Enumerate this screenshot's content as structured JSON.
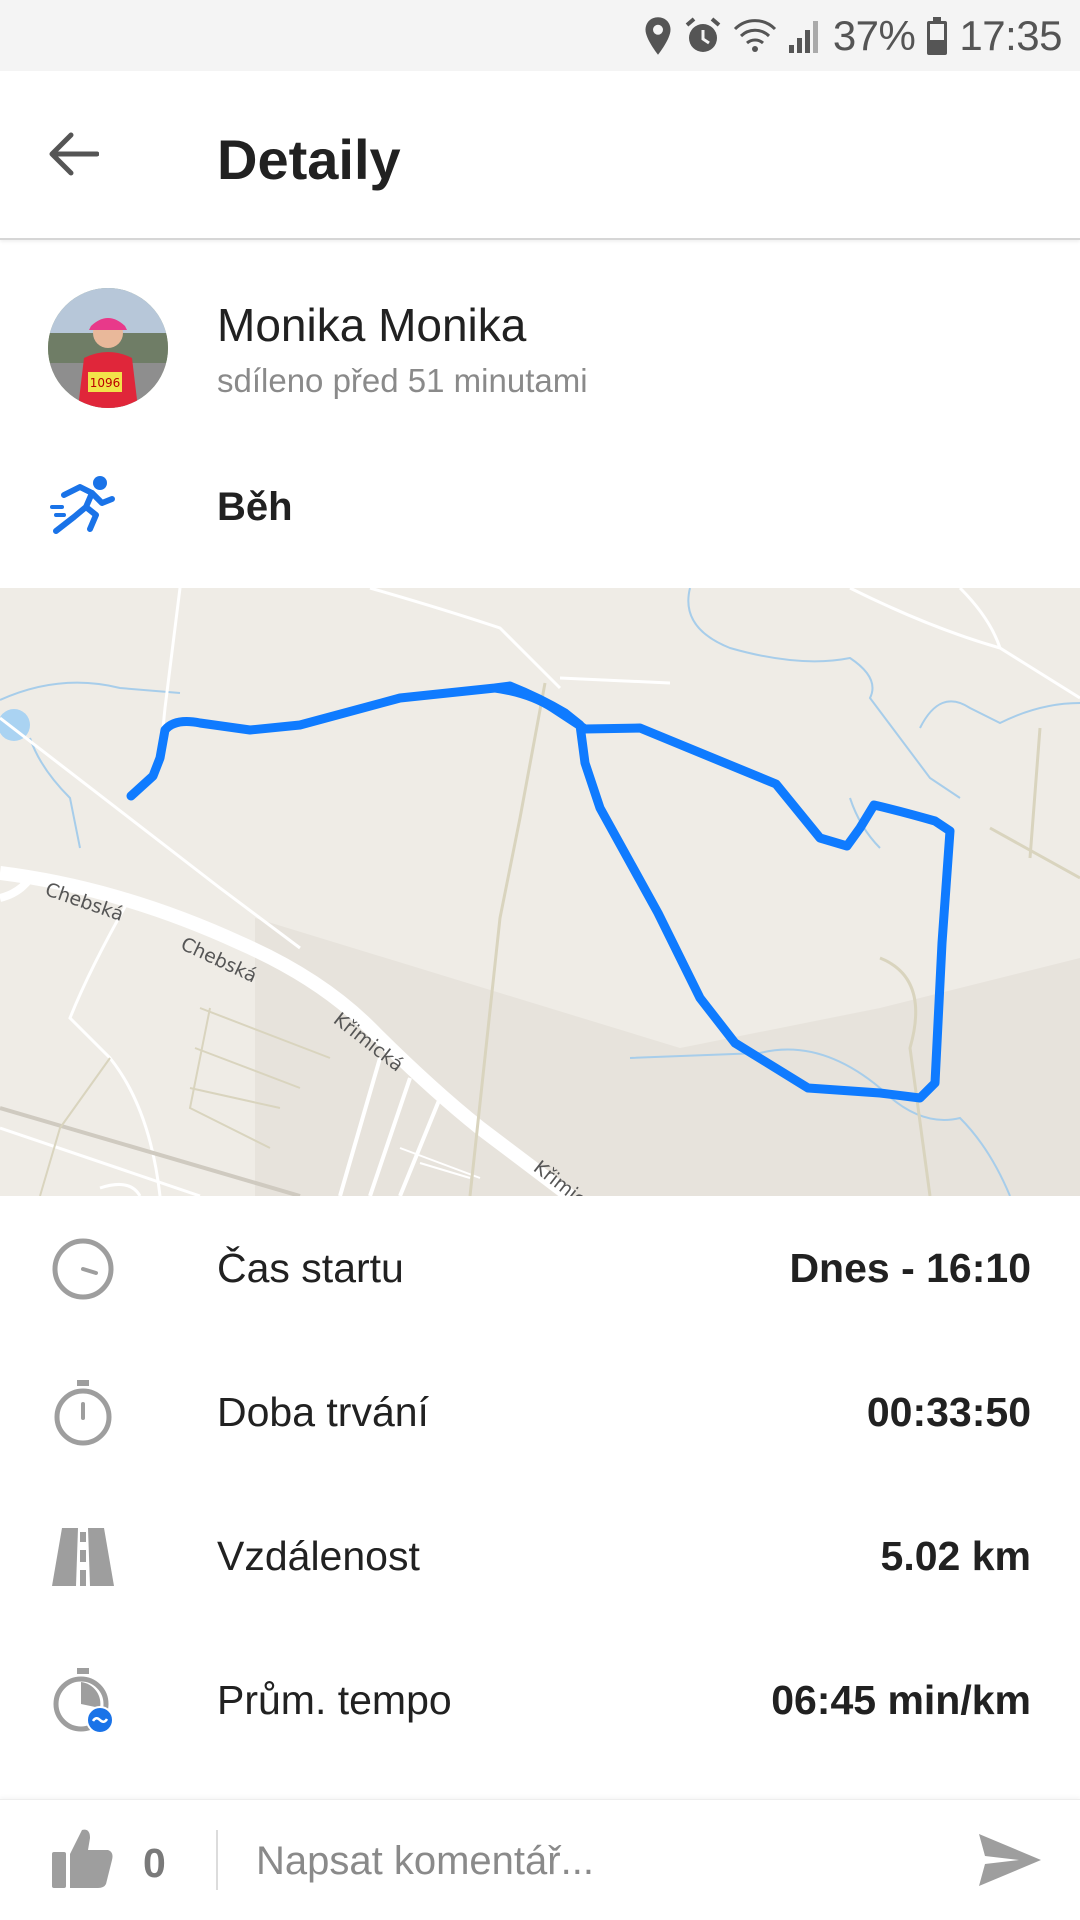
{
  "status_bar": {
    "battery": "37%",
    "time": "17:35",
    "icons": [
      "location-icon",
      "alarm-icon",
      "wifi-icon",
      "signal-icon",
      "battery-icon"
    ]
  },
  "app_bar": {
    "title": "Detaily",
    "back_icon": "arrow-back-icon"
  },
  "profile": {
    "name": "Monika Monika",
    "shared": "sdíleno před 51 minutami"
  },
  "activity": {
    "label": "Běh",
    "icon": "running-icon"
  },
  "map": {
    "street_labels": [
      "Chebská",
      "Chebská",
      "Křimická",
      "Křimick"
    ],
    "route_color": "#0f7bff"
  },
  "stats": [
    {
      "icon": "clock-icon",
      "label": "Čas startu",
      "value": "Dnes - 16:10"
    },
    {
      "icon": "stopwatch-icon",
      "label": "Doba trvání",
      "value": "00:33:50"
    },
    {
      "icon": "road-icon",
      "label": "Vzdálenost",
      "value": "5.02 km"
    },
    {
      "icon": "pace-icon",
      "label": "Prům. tempo",
      "value": "06:45 min/km"
    }
  ],
  "footer": {
    "like_count": "0",
    "comment_placeholder": "Napsat komentář...",
    "like_icon": "thumbs-up-icon",
    "send_icon": "send-icon"
  },
  "colors": {
    "accent": "#1a73e8",
    "map_background": "#efece6",
    "icon_gray": "#9e9e9e"
  }
}
